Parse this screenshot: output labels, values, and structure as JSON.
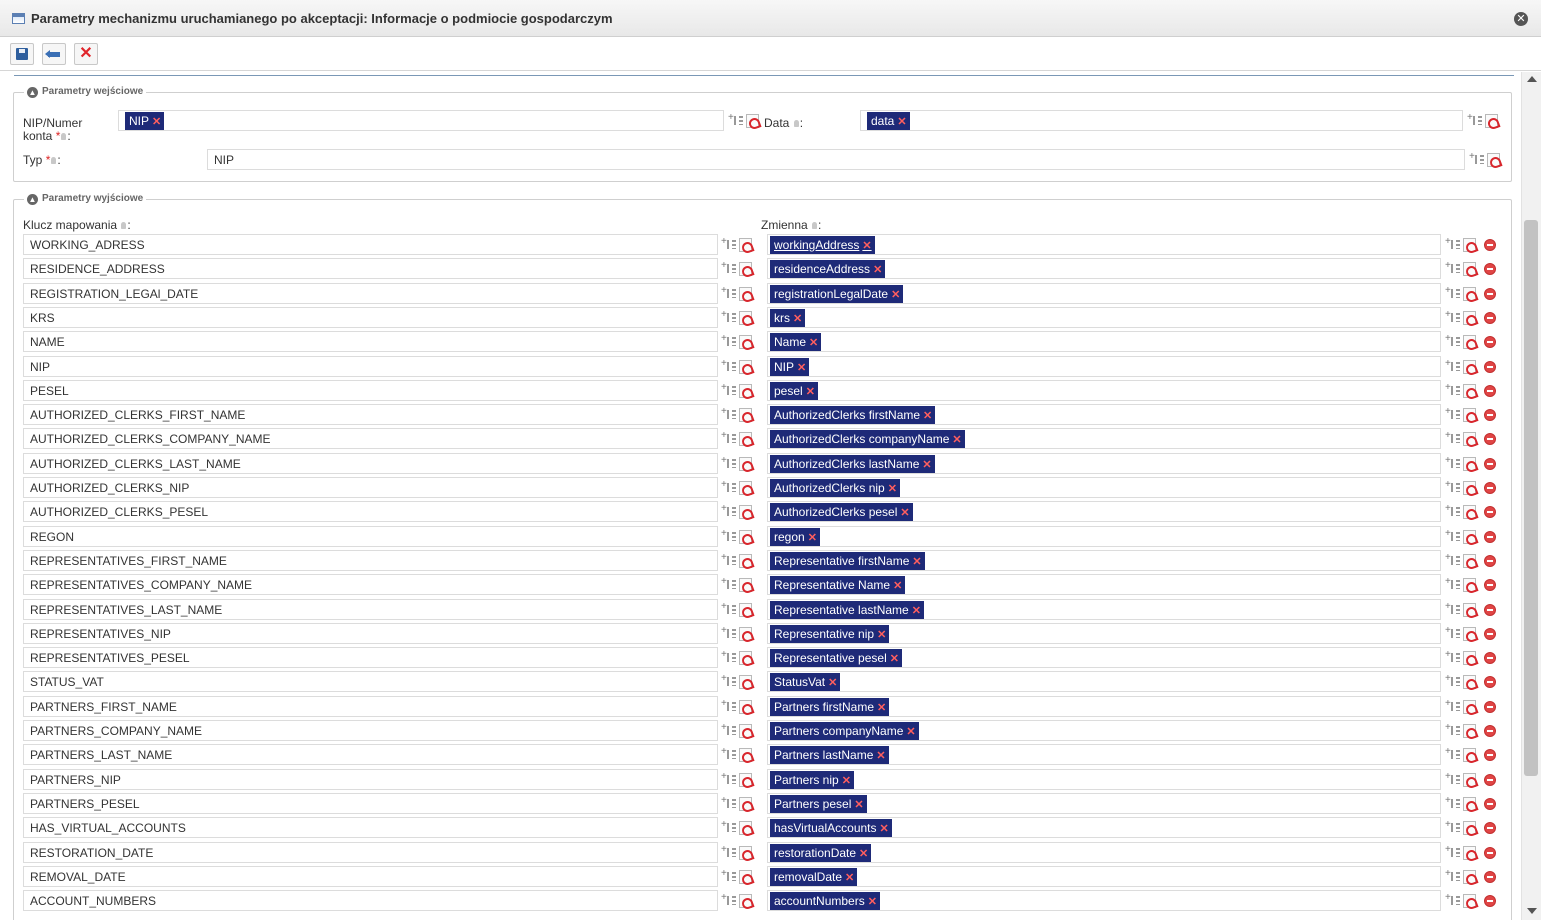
{
  "window": {
    "title": "Parametry mechanizmu uruchamianego po akceptacji: Informacje o podmiocie gospodarczym"
  },
  "input_section": {
    "legend": "Parametry wejściowe",
    "nip_label_line1": "NIP/Numer",
    "nip_label_line2": "konta",
    "nip_chip": "NIP",
    "data_label": "Data",
    "data_chip": "data",
    "typ_label": "Typ",
    "typ_value": "NIP"
  },
  "output_section": {
    "legend": "Parametry wyjściowe",
    "key_header": "Klucz mapowania",
    "var_header": "Zmienna",
    "rows": [
      {
        "key": "WORKING_ADRESS",
        "var": "workingAddress"
      },
      {
        "key": "RESIDENCE_ADDRESS",
        "var": "residenceAddress"
      },
      {
        "key": "REGISTRATION_LEGAl_DATE",
        "var": "registrationLegalDate"
      },
      {
        "key": "KRS",
        "var": "krs"
      },
      {
        "key": "NAME",
        "var": "Name"
      },
      {
        "key": "NIP",
        "var": "NIP"
      },
      {
        "key": "PESEL",
        "var": "pesel"
      },
      {
        "key": "AUTHORIZED_CLERKS_FIRST_NAME",
        "var": "AuthorizedClerks firstName"
      },
      {
        "key": "AUTHORIZED_CLERKS_COMPANY_NAME",
        "var": "AuthorizedClerks companyName"
      },
      {
        "key": "AUTHORIZED_CLERKS_LAST_NAME",
        "var": "AuthorizedClerks lastName"
      },
      {
        "key": "AUTHORIZED_CLERKS_NIP",
        "var": "AuthorizedClerks nip"
      },
      {
        "key": "AUTHORIZED_CLERKS_PESEL",
        "var": "AuthorizedClerks pesel"
      },
      {
        "key": "REGON",
        "var": "regon"
      },
      {
        "key": "REPRESENTATIVES_FIRST_NAME",
        "var": "Representative firstName"
      },
      {
        "key": "REPRESENTATIVES_COMPANY_NAME",
        "var": "Representative Name"
      },
      {
        "key": "REPRESENTATIVES_LAST_NAME",
        "var": "Representative lastName"
      },
      {
        "key": "REPRESENTATIVES_NIP",
        "var": "Representative nip"
      },
      {
        "key": "REPRESENTATIVES_PESEL",
        "var": "Representative pesel"
      },
      {
        "key": "STATUS_VAT",
        "var": "StatusVat"
      },
      {
        "key": "PARTNERS_FIRST_NAME",
        "var": "Partners firstName"
      },
      {
        "key": "PARTNERS_COMPANY_NAME",
        "var": "Partners companyName"
      },
      {
        "key": "PARTNERS_LAST_NAME",
        "var": "Partners lastName"
      },
      {
        "key": "PARTNERS_NIP",
        "var": "Partners nip"
      },
      {
        "key": "PARTNERS_PESEL",
        "var": "Partners pesel"
      },
      {
        "key": "HAS_VIRTUAL_ACCOUNTS",
        "var": "hasVirtualAccounts"
      },
      {
        "key": "RESTORATION_DATE",
        "var": "restorationDate"
      },
      {
        "key": "REMOVAL_DATE",
        "var": "removalDate"
      },
      {
        "key": "ACCOUNT_NUMBERS",
        "var": "accountNumbers"
      }
    ]
  },
  "colors": {
    "chip_bg": "#1e2a78",
    "chip_remove": "#ff5f5f",
    "remove_button": "#e04545"
  }
}
